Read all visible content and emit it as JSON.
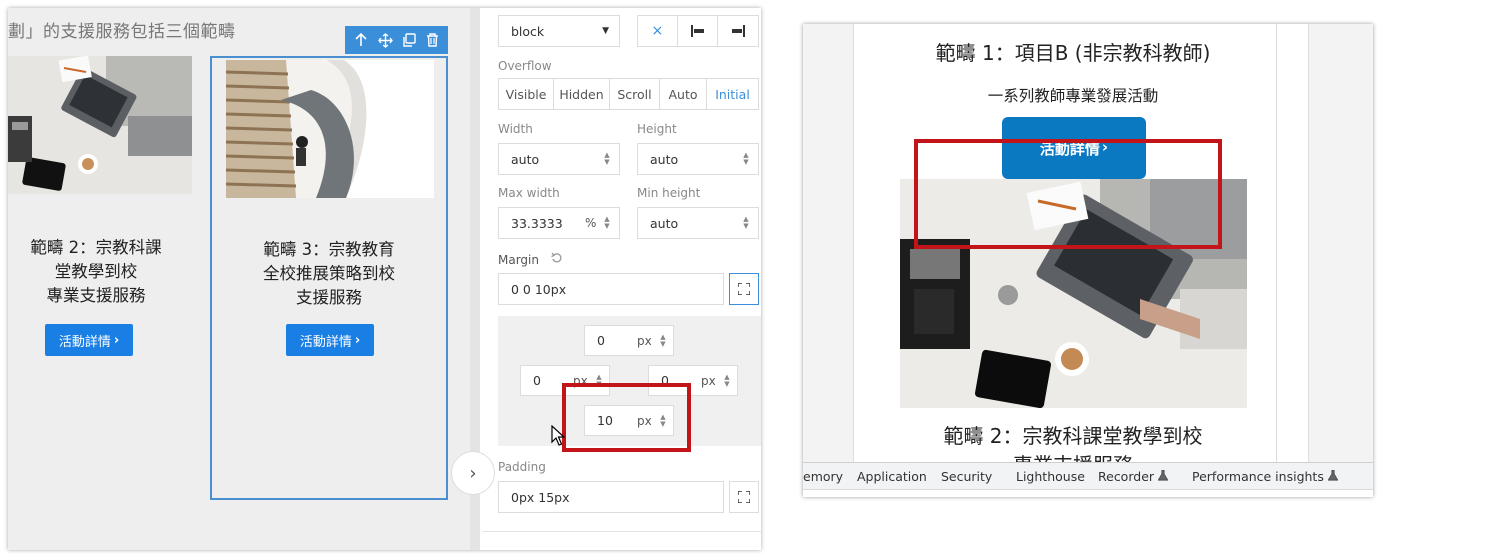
{
  "canvas": {
    "heading": "劃」的支援服務包括三個範疇",
    "cards": [
      {
        "title_lines": [
          "範疇 2：宗教科課",
          "堂教學到校",
          "專業支援服務"
        ],
        "button": "活動詳情"
      },
      {
        "title_lines": [
          "範疇 3：宗教教育",
          "全校推展策略到校",
          "支援服務"
        ],
        "button": "活動詳情"
      }
    ],
    "toolbar_icons": [
      "arrow-up-icon",
      "move-icon",
      "copy-icon",
      "trash-icon"
    ]
  },
  "style_panel": {
    "display": {
      "value": "block"
    },
    "overflow": {
      "label": "Overflow",
      "options": [
        "Visible",
        "Hidden",
        "Scroll",
        "Auto",
        "Initial"
      ],
      "active": "Initial"
    },
    "width": {
      "label": "Width",
      "value": "auto"
    },
    "height": {
      "label": "Height",
      "value": "auto"
    },
    "max_width": {
      "label": "Max width",
      "value": "33.3333",
      "unit": "%"
    },
    "min_height": {
      "label": "Min height",
      "value": "auto"
    },
    "margin": {
      "label": "Margin",
      "value": "0 0 10px"
    },
    "box": {
      "top": {
        "value": "0",
        "unit": "px"
      },
      "left": {
        "value": "0",
        "unit": "px"
      },
      "right": {
        "value": "0",
        "unit": "px"
      },
      "bottom": {
        "value": "10",
        "unit": "px"
      }
    },
    "padding": {
      "label": "Padding",
      "value": "0px 15px"
    }
  },
  "preview": {
    "title": "範疇 1：項目B (非宗教科教師)",
    "subtitle": "一系列教師專業發展活動",
    "button": "活動詳情",
    "title2_line1": "範疇 2：宗教科課堂教學到校",
    "title2_line2": "專業支援服務"
  },
  "devtools": {
    "tabs": [
      "emory",
      "Application",
      "Security",
      "Lighthouse",
      "Recorder",
      "Performance insights"
    ]
  },
  "colors": {
    "accent": "#3b8fd8",
    "button_blue": "#1a7fe5",
    "preview_button": "#0b78c2",
    "highlight_red": "#c3141a"
  }
}
